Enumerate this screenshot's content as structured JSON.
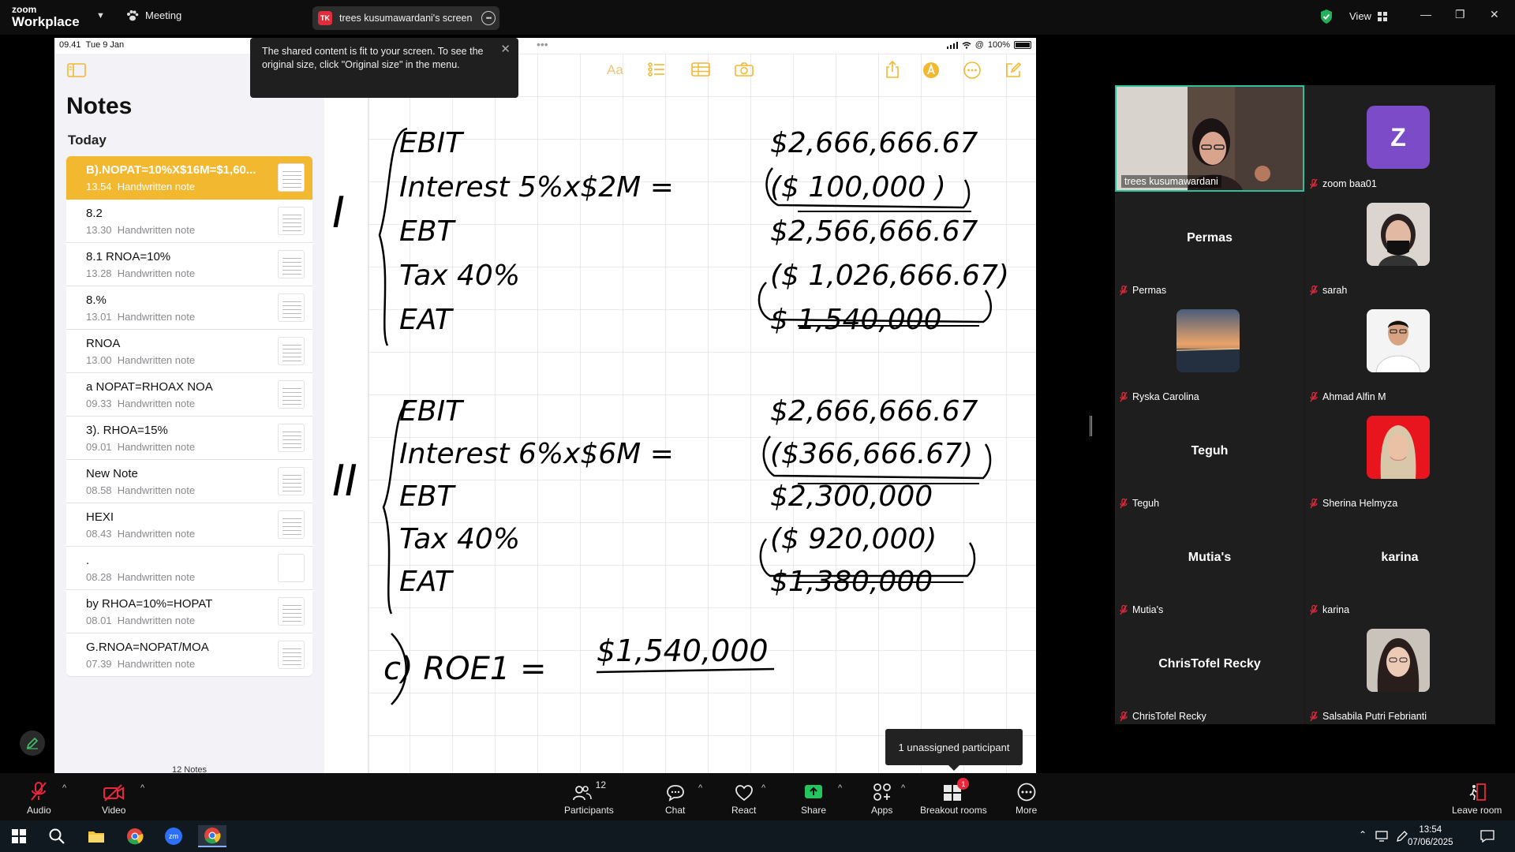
{
  "app": {
    "brand_top": "zoom",
    "brand_bottom": "Workplace"
  },
  "topbar": {
    "meeting_label": "Meeting",
    "share_initials": "TK",
    "share_label": "trees kusumawardani's screen",
    "view_label": "View"
  },
  "ipad": {
    "time": "09.41",
    "date": "Tue 9 Jan",
    "battery": "100%"
  },
  "notes": {
    "title": "Notes",
    "section": "Today",
    "count_label": "12 Notes",
    "items": [
      {
        "title": "B).NOPAT=10%X$16M=$1,60...",
        "time": "13.54",
        "kind": "Handwritten note"
      },
      {
        "title": "8.2",
        "time": "13.30",
        "kind": "Handwritten note"
      },
      {
        "title": "8.1 RNOA=10%",
        "time": "13.28",
        "kind": "Handwritten note"
      },
      {
        "title": "8.%",
        "time": "13.01",
        "kind": "Handwritten note"
      },
      {
        "title": "RNOA",
        "time": "13.00",
        "kind": "Handwritten note"
      },
      {
        "title": "a NOPAT=RHOAX NOA",
        "time": "09.33",
        "kind": "Handwritten note"
      },
      {
        "title": "3). RHOA=15%",
        "time": "09.01",
        "kind": "Handwritten note"
      },
      {
        "title": "New Note",
        "time": "08.58",
        "kind": "Handwritten note"
      },
      {
        "title": "HEXI",
        "time": "08.43",
        "kind": "Handwritten note"
      },
      {
        "title": ".",
        "time": "08.28",
        "kind": "Handwritten note"
      },
      {
        "title": "by RHOA=10%=HOPAT",
        "time": "08.01",
        "kind": "Handwritten note"
      },
      {
        "title": "G.RNOA=NOPAT/MOA",
        "time": "07.39",
        "kind": "Handwritten note"
      }
    ]
  },
  "tooltip": {
    "text": "The shared content is fit to your screen. To see the original size, click \"Original size\" in the menu."
  },
  "handwriting": {
    "s1_label": "I",
    "s1": [
      [
        "EBIT",
        "$2,666,666.67"
      ],
      [
        "Interest 5%x$2M =",
        "($ 100,000 )"
      ],
      [
        "EBT",
        "$2,566,666.67"
      ],
      [
        "Tax 40%",
        "($ 1,026,666.67)"
      ],
      [
        "EAT",
        "$ 1,540,000"
      ]
    ],
    "s2_label": "II",
    "s2": [
      [
        "EBIT",
        "$2,666,666.67"
      ],
      [
        "Interest 6%x$6M =",
        "($366,666.67)"
      ],
      [
        "EBT",
        "$2,300,000"
      ],
      [
        "Tax 40%",
        "($ 920,000)"
      ],
      [
        "EAT",
        "$1,380,000"
      ]
    ],
    "roe": "c) ROE1 =",
    "roe_value": "$1,540,000"
  },
  "gallery": [
    {
      "name": "trees kusumawardani",
      "kind": "video"
    },
    {
      "name": "zoom baa01",
      "kind": "avatar",
      "initial": "Z",
      "color": "#7b4bc8"
    },
    {
      "name": "Permas",
      "kind": "name"
    },
    {
      "name": "sarah",
      "kind": "photo"
    },
    {
      "name": "Ryska Carolina",
      "kind": "photo"
    },
    {
      "name": "Ahmad Alfin M",
      "kind": "photo"
    },
    {
      "name": "Teguh",
      "kind": "name"
    },
    {
      "name": "Sherina Helmyza",
      "kind": "photo"
    },
    {
      "name": "Mutia's",
      "kind": "name"
    },
    {
      "name": "karina",
      "kind": "name"
    },
    {
      "name": "ChrisTofel Recky",
      "kind": "name"
    },
    {
      "name": "Salsabila Putri Febrianti",
      "kind": "photo"
    }
  ],
  "unassigned": "1 unassigned participant",
  "controls": {
    "audio": "Audio",
    "video": "Video",
    "participants": "Participants",
    "participants_count": "12",
    "chat": "Chat",
    "react": "React",
    "share": "Share",
    "apps": "Apps",
    "breakout": "Breakout rooms",
    "breakout_badge": "1",
    "more": "More",
    "leave": "Leave room"
  },
  "taskbar": {
    "time": "13:54",
    "date": "07/06/2025"
  },
  "colors": {
    "accent_green": "#2ec09c",
    "notes_yellow": "#f2b830",
    "share_green": "#22c55e",
    "mute_red": "#e8283a"
  }
}
